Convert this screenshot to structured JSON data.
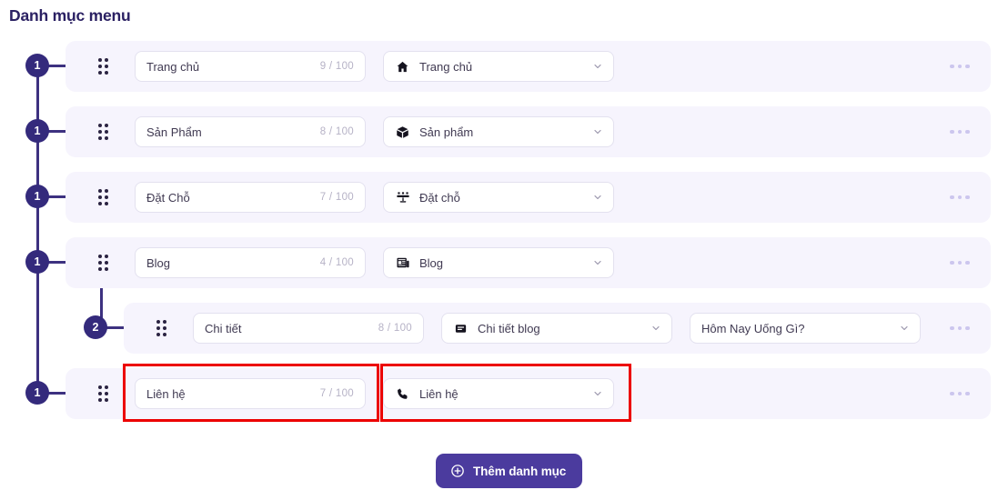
{
  "header": {
    "title": "Danh mục menu"
  },
  "rows": [
    {
      "level": 1,
      "badge": "1",
      "name_value": "Trang chủ",
      "counter": "9 / 100",
      "select_label": "Trang chủ",
      "select_icon": "home-icon",
      "more_label": "•••"
    },
    {
      "level": 1,
      "badge": "1",
      "name_value": "Sản Phẩm",
      "counter": "8 / 100",
      "select_label": "Sản phẩm",
      "select_icon": "box-icon",
      "more_label": "•••"
    },
    {
      "level": 1,
      "badge": "1",
      "name_value": "Đặt Chỗ",
      "counter": "7 / 100",
      "select_label": "Đặt chỗ",
      "select_icon": "table-seats-icon",
      "more_label": "•••"
    },
    {
      "level": 1,
      "badge": "1",
      "name_value": "Blog",
      "counter": "4 / 100",
      "select_label": "Blog",
      "select_icon": "newspaper-icon",
      "more_label": "•••"
    },
    {
      "level": 2,
      "badge": "2",
      "name_value": "Chi tiết",
      "counter": "8 / 100",
      "select_label": "Chi tiết blog",
      "select_icon": "article-icon",
      "extra_select_label": "Hôm Nay Uống Gì?",
      "more_label": "•••"
    },
    {
      "level": 1,
      "badge": "1",
      "name_value": "Liên hệ",
      "counter": "7 / 100",
      "select_label": "Liên hệ",
      "select_icon": "phone-icon",
      "more_label": "•••"
    }
  ],
  "footer": {
    "add_label": "Thêm danh mục",
    "add_icon": "plus-circle-icon"
  },
  "colors": {
    "brand_purple": "#4b3b9e",
    "node_indigo": "#342a7c",
    "row_background": "#f6f4fd",
    "title_color": "#2b2163",
    "highlight_red": "#ec0000"
  }
}
